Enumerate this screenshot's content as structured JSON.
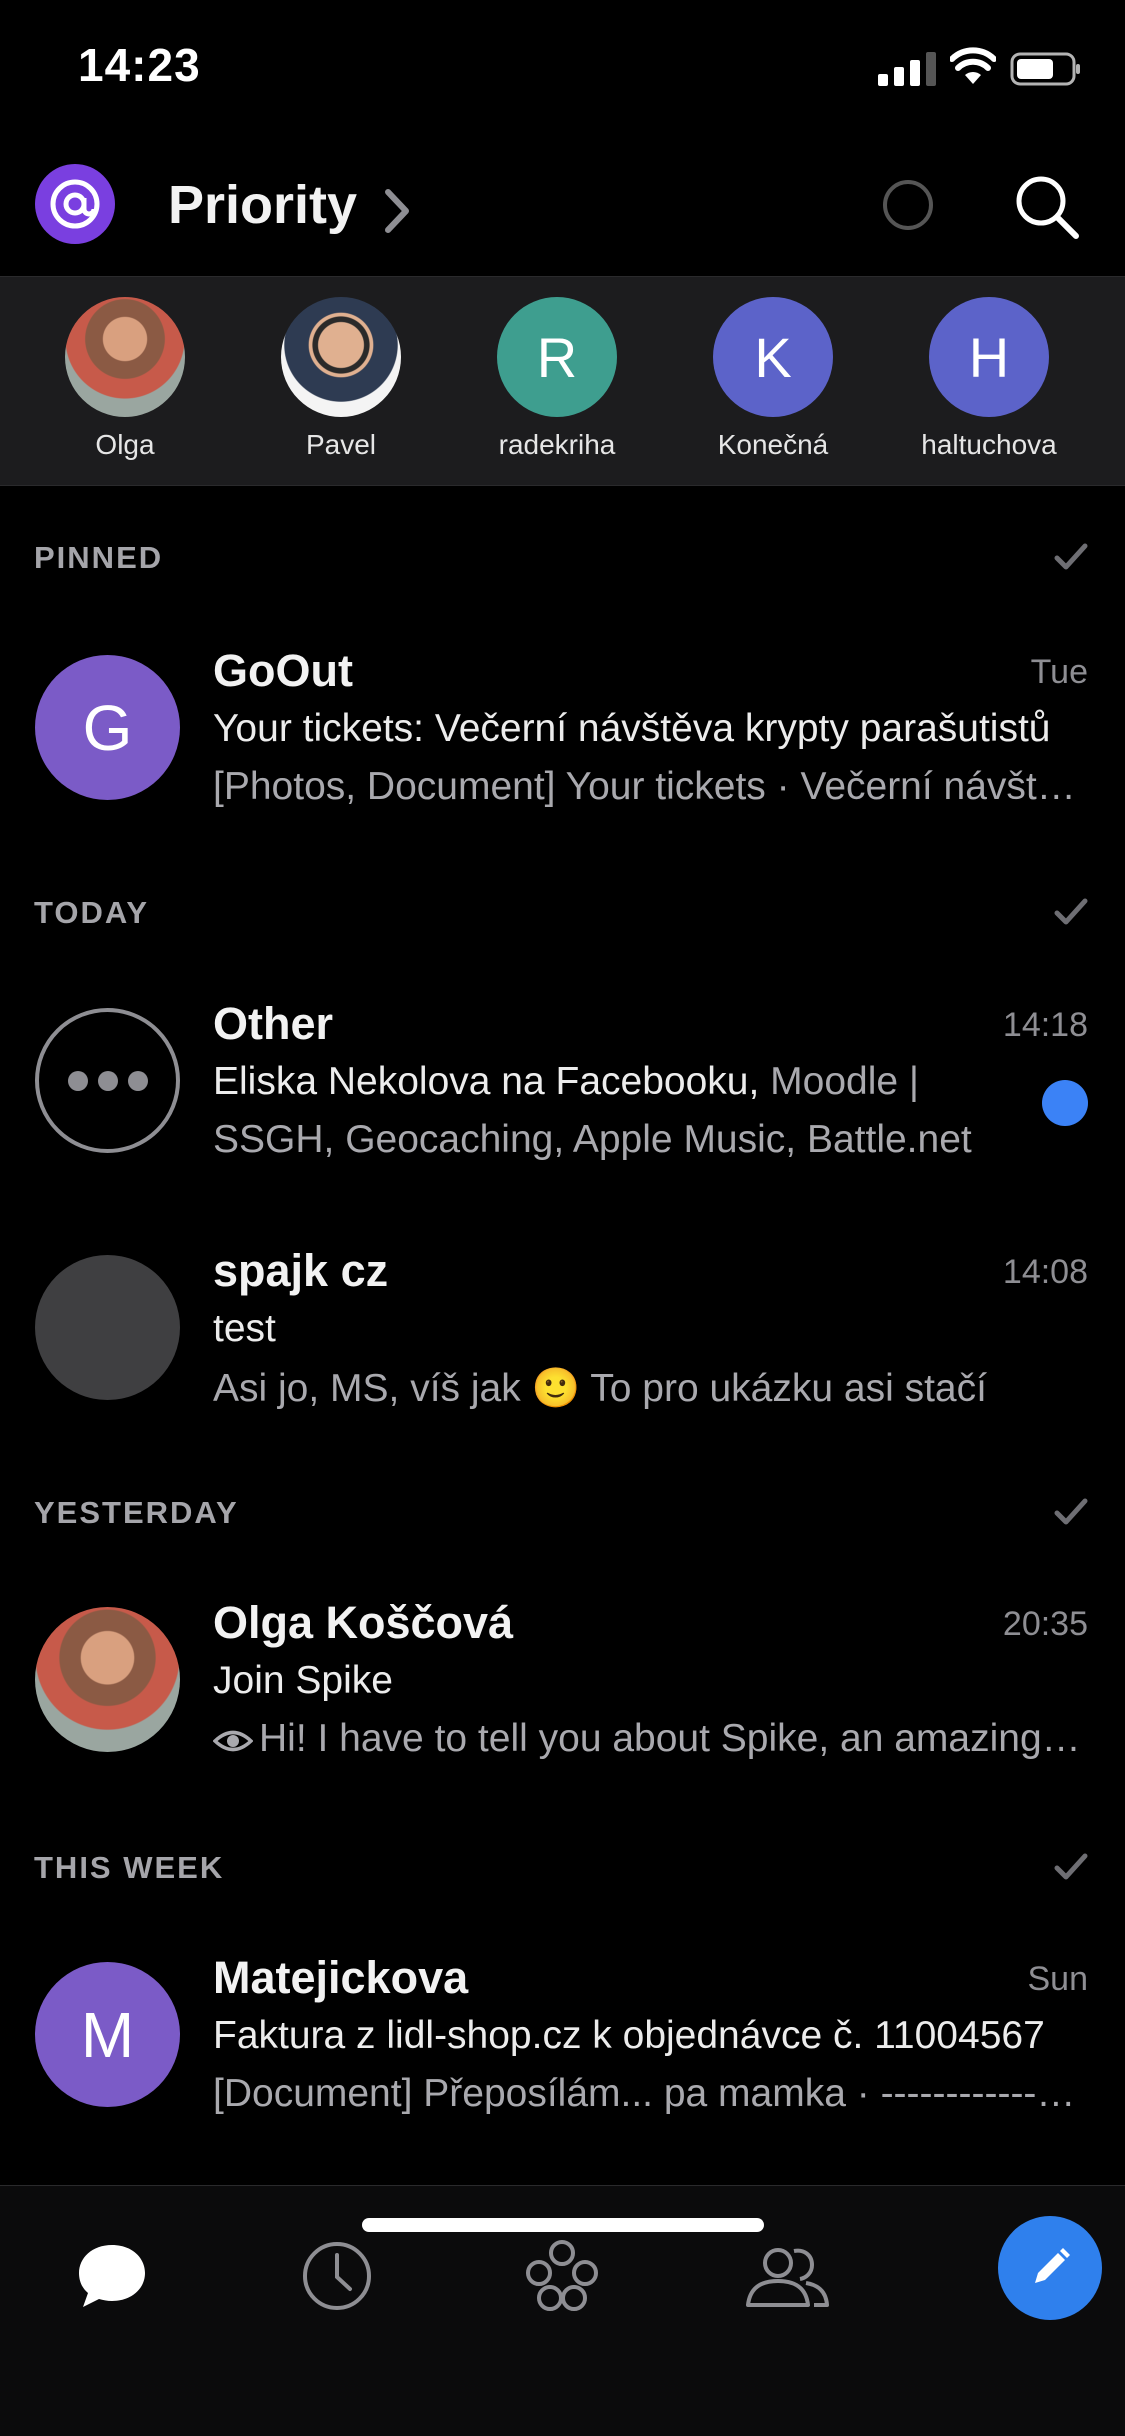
{
  "status_bar": {
    "time": "14:23"
  },
  "header": {
    "title": "Priority"
  },
  "contacts": [
    {
      "name": "Olga",
      "initial": "",
      "color": "#7a5a48"
    },
    {
      "name": "Pavel",
      "initial": "",
      "color": "#d9d9d9"
    },
    {
      "name": "radekriha",
      "initial": "R",
      "color": "#3e9e8f"
    },
    {
      "name": "Konečná",
      "initial": "K",
      "color": "#5c63c9"
    },
    {
      "name": "haltuchova",
      "initial": "H",
      "color": "#5c63c9"
    }
  ],
  "sections": {
    "pinned": "PINNED",
    "today": "TODAY",
    "yesterday": "YESTERDAY",
    "this_week": "THIS WEEK"
  },
  "messages": {
    "gooout": {
      "initial": "G",
      "sender": "GoOut",
      "time": "Tue",
      "subject": "Your tickets: Večerní návštěva krypty parašutistů",
      "preview": "[Photos, Document] Your tickets · Večerní návštěva"
    },
    "other": {
      "sender": "Other",
      "time": "14:18",
      "subject_main": "Eliska Nekolova na Facebooku,",
      "subject_rest": " Moodle |",
      "preview": "SSGH, Geocaching, Apple Music, Battle.net"
    },
    "spajk": {
      "sender": "spajk cz",
      "time": "14:08",
      "subject": "test",
      "preview": "Asi jo, MS, víš jak 🙂 To pro ukázku asi stačí"
    },
    "olga": {
      "sender": "Olga Koščová",
      "time": "20:35",
      "subject": "Join Spike",
      "preview": "Hi! I have to tell you about Spike, an amazing app"
    },
    "matejickova": {
      "initial": "M",
      "sender": "Matejickova",
      "time": "Sun",
      "subject": "Faktura z lidl-shop.cz k objednávce č. 11004567",
      "preview": "[Document] Přeposílám... pa mamka · ----------------"
    }
  },
  "colors": {
    "accent": "#2f80ed",
    "purple_avatar": "#7b5bc7",
    "unread": "#3b82f6"
  },
  "icons": {
    "chat_tab": "chat-bubble-icon",
    "later_tab": "clock-icon",
    "groups_tab": "circles-icon",
    "people_tab": "people-icon",
    "compose": "pencil-icon"
  }
}
